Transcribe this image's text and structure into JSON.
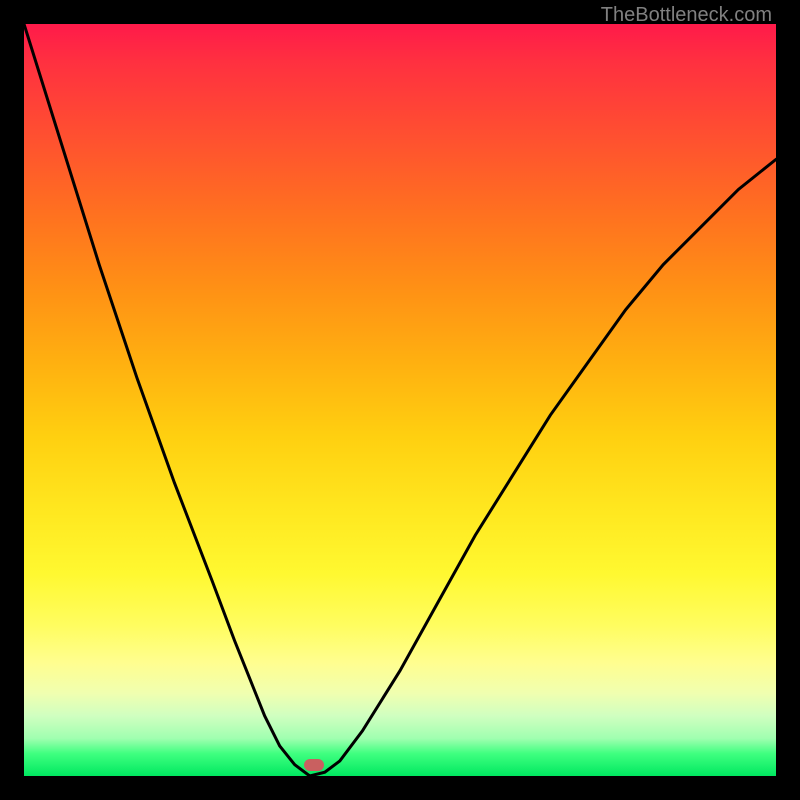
{
  "watermark": "TheBottleneck.com",
  "chart_data": {
    "type": "line",
    "title": "",
    "xlabel": "",
    "ylabel": "",
    "xlim": [
      0,
      100
    ],
    "ylim": [
      0,
      100
    ],
    "series": [
      {
        "name": "bottleneck-curve",
        "x": [
          0,
          5,
          10,
          15,
          20,
          25,
          28,
          30,
          32,
          34,
          36,
          38,
          40,
          42,
          45,
          50,
          55,
          60,
          65,
          70,
          75,
          80,
          85,
          90,
          95,
          100
        ],
        "values": [
          100,
          84,
          68,
          53,
          39,
          26,
          18,
          13,
          8,
          4,
          1.5,
          0,
          0.5,
          2,
          6,
          14,
          23,
          32,
          40,
          48,
          55,
          62,
          68,
          73,
          78,
          82
        ]
      }
    ],
    "gradient_meaning": "red=high bottleneck, green=low bottleneck",
    "marker": {
      "x_percent": 38.5,
      "y_percent": 98.6
    }
  }
}
